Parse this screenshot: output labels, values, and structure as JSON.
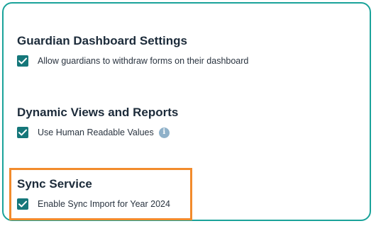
{
  "sections": [
    {
      "title": "Guardian Dashboard Settings",
      "options": [
        {
          "label": "Allow guardians to withdraw forms on their dashboard",
          "checked": true
        }
      ]
    },
    {
      "title": "Dynamic Views and Reports",
      "options": [
        {
          "label": "Use Human Readable Values",
          "checked": true,
          "info_icon": "info-icon"
        }
      ]
    },
    {
      "title": "Sync Service",
      "options": [
        {
          "label": "Enable Sync Import for Year 2024",
          "checked": true
        }
      ]
    }
  ],
  "colors": {
    "frame_border": "#1aa39a",
    "checkbox_fill": "#15777a",
    "highlight_border": "#f28b2c",
    "info_icon": "#8fb1c9"
  }
}
